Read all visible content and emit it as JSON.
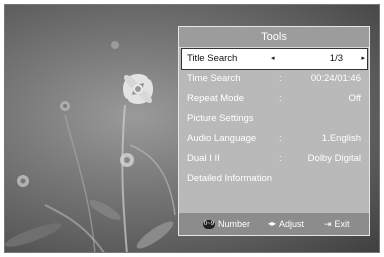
{
  "panel": {
    "title": "Tools",
    "items": [
      {
        "label": "Title Search",
        "sep": "",
        "value": "1/3",
        "selected": true
      },
      {
        "label": "Time Search",
        "sep": ":",
        "value": "00:24/01:46"
      },
      {
        "label": "Repeat Mode",
        "sep": ":",
        "value": "Off"
      },
      {
        "label": "Picture Settings",
        "sep": "",
        "value": ""
      },
      {
        "label": "Audio Language",
        "sep": ":",
        "value": "1.English"
      },
      {
        "label": "Dual I II",
        "sep": ":",
        "value": "Dolby Digital"
      },
      {
        "label": "Detailed Information",
        "sep": "",
        "value": ""
      }
    ],
    "footer": {
      "number_icon": "0~9",
      "number_label": "Number",
      "adjust_icon": "◂▸",
      "adjust_label": "Adjust",
      "exit_icon": "⇥",
      "exit_label": "Exit"
    }
  },
  "icons": [
    "left-arrow-icon",
    "right-arrow-icon",
    "number-keys-icon",
    "left-right-icon",
    "exit-icon"
  ]
}
